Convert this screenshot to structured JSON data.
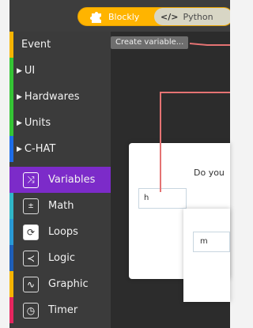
{
  "toolbar": {
    "blockly_label": "Blockly",
    "python_label": "Python",
    "python_glyph": "</>"
  },
  "sidebar": {
    "items": [
      {
        "label": "Event",
        "color": "#f5b400",
        "arrow": false,
        "icon": null
      },
      {
        "label": "UI",
        "color": "#35c535",
        "arrow": true,
        "icon": null
      },
      {
        "label": "Hardwares",
        "color": "#35c535",
        "arrow": true,
        "icon": null
      },
      {
        "label": "Units",
        "color": "#35c535",
        "arrow": true,
        "icon": null
      },
      {
        "label": "C-HAT",
        "color": "#1e6de8",
        "arrow": true,
        "icon": null
      },
      {
        "label": "Variables",
        "color": "#7c2bc9",
        "arrow": false,
        "icon": "variables-icon",
        "selected": true
      },
      {
        "label": "Math",
        "color": "#31b6c7",
        "arrow": false,
        "icon": "math-icon"
      },
      {
        "label": "Loops",
        "color": "#2a9ad6",
        "arrow": false,
        "icon": "loops-icon"
      },
      {
        "label": "Logic",
        "color": "#1f5fb8",
        "arrow": false,
        "icon": "logic-icon"
      },
      {
        "label": "Graphic",
        "color": "#f5b400",
        "arrow": false,
        "icon": "graphic-icon"
      },
      {
        "label": "Timer",
        "color": "#e5265f",
        "arrow": false,
        "icon": "timer-icon"
      }
    ]
  },
  "workspace": {
    "create_variable_label": "Create variable..."
  },
  "dialog": {
    "question": "Do you",
    "input1_value": "h",
    "input2_value": "m"
  },
  "colors": {
    "accent": "#ffb400",
    "callout": "#e57373"
  }
}
